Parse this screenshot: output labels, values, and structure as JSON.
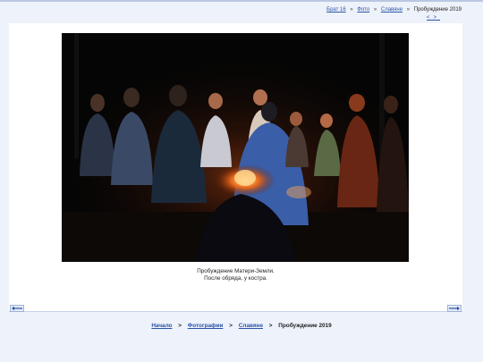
{
  "breadcrumb_top": {
    "items": [
      "Брат 16",
      "Фото",
      "Славяне"
    ],
    "current": "Пробуждение 2019",
    "separator": "»"
  },
  "mini_nav": {
    "prev": "<",
    "next": ">"
  },
  "caption": {
    "line1": "Пробуждение Матери-Земли.",
    "line2": "После обряда, у костра."
  },
  "breadcrumb_bottom": {
    "items": [
      "Начало",
      "Фотографии",
      "Славяне"
    ],
    "current": "Пробуждение 2019",
    "separator": ">"
  },
  "colors": {
    "link": "#2b55a8",
    "page_bg": "#eef2fa",
    "panel_bg": "#ffffff",
    "photo_bg": "#050505"
  },
  "icons": {
    "prev": "left-arrow-icon",
    "next": "right-arrow-icon"
  }
}
